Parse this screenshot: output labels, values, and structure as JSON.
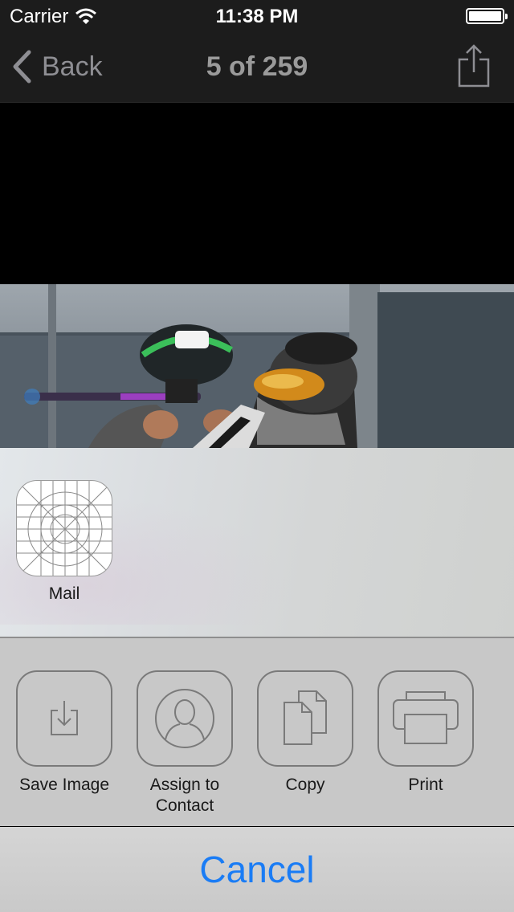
{
  "status": {
    "carrier": "Carrier",
    "time": "11:38 PM"
  },
  "nav": {
    "back_label": "Back",
    "title": "5 of 259"
  },
  "share_apps": [
    {
      "label": "Mail",
      "icon": "mail-placeholder-icon"
    }
  ],
  "actions": [
    {
      "label": "Save Image",
      "icon": "save-image-icon"
    },
    {
      "label": "Assign to Contact",
      "icon": "assign-contact-icon"
    },
    {
      "label": "Copy",
      "icon": "copy-icon"
    },
    {
      "label": "Print",
      "icon": "print-icon"
    }
  ],
  "cancel_label": "Cancel",
  "colors": {
    "accent": "#1a7cf5",
    "navbar": "#1c1c1c"
  }
}
